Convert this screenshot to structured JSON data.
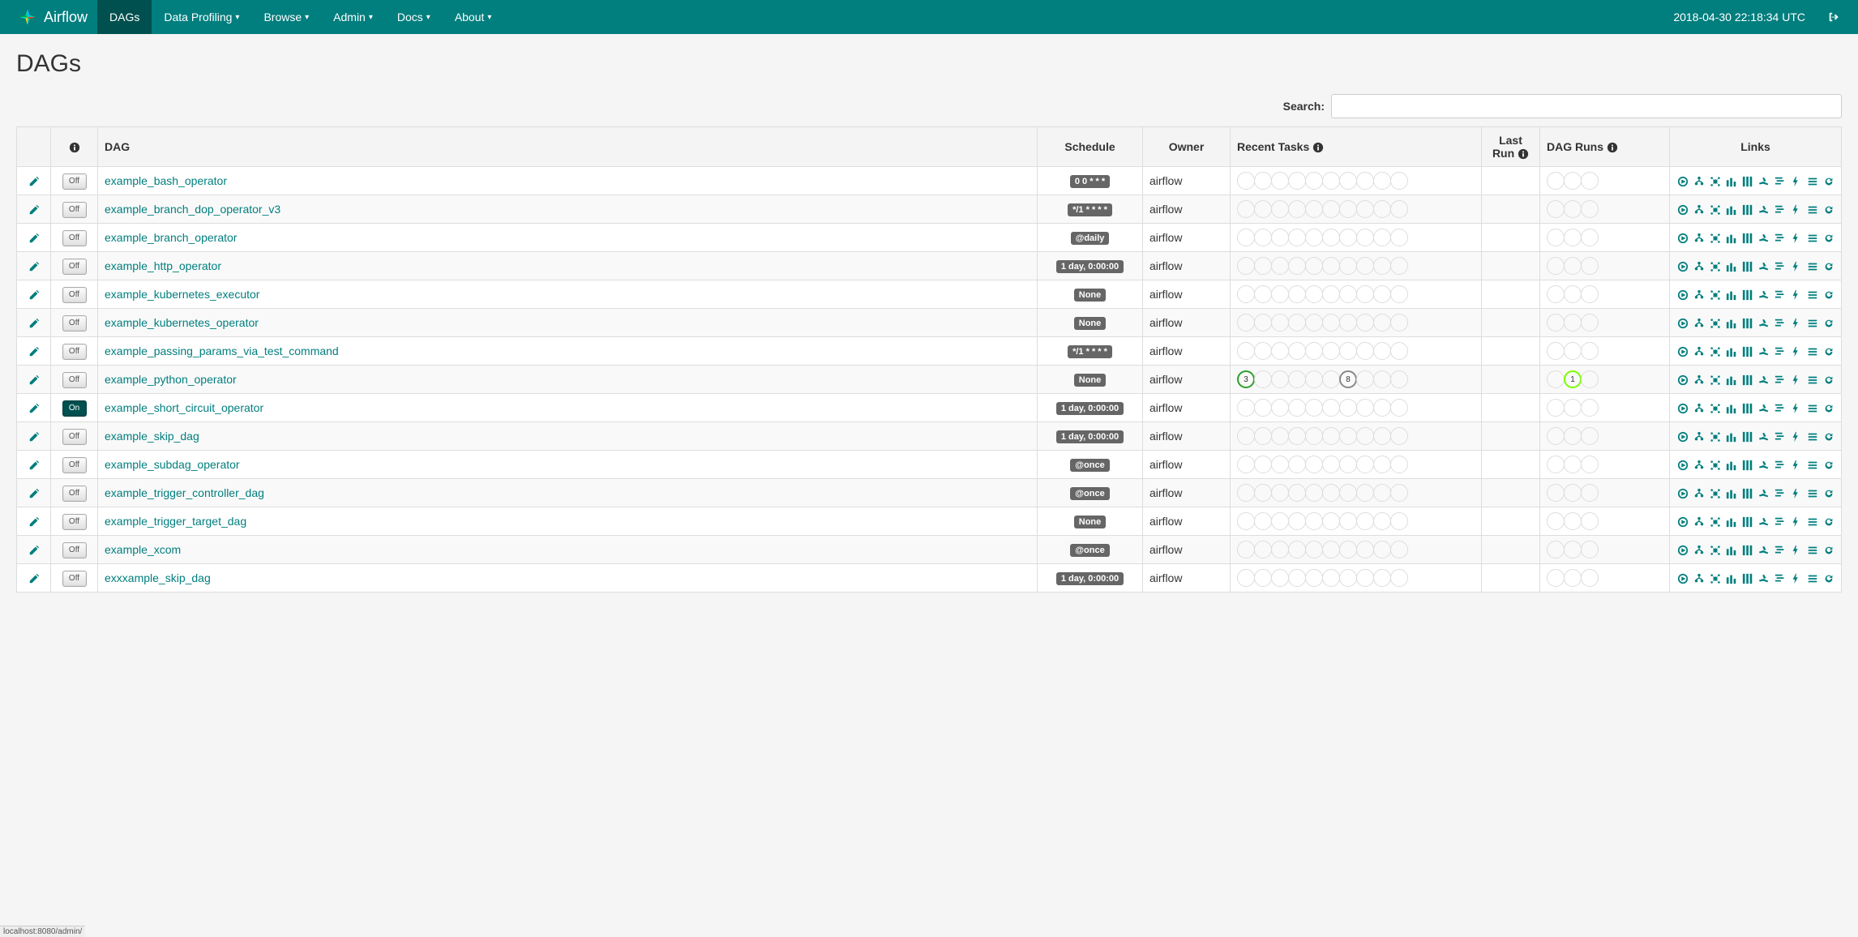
{
  "header": {
    "brand": "Airflow",
    "nav": [
      "DAGs",
      "Data Profiling",
      "Browse",
      "Admin",
      "Docs",
      "About"
    ],
    "active_index": 0,
    "timestamp": "2018-04-30 22:18:34 UTC"
  },
  "page": {
    "title": "DAGs",
    "search_label": "Search:",
    "search_value": ""
  },
  "table": {
    "headers": {
      "edit": "",
      "toggle": "",
      "dag": "DAG",
      "schedule": "Schedule",
      "owner": "Owner",
      "recent": "Recent Tasks",
      "lastrun": "Last Run",
      "dagrun": "DAG Runs",
      "links": "Links"
    },
    "rows": [
      {
        "name": "example_bash_operator",
        "toggle": "Off",
        "schedule": "0 0 * * *",
        "owner": "airflow",
        "recent": [],
        "dagrun": []
      },
      {
        "name": "example_branch_dop_operator_v3",
        "toggle": "Off",
        "schedule": "*/1 * * * *",
        "owner": "airflow",
        "recent": [],
        "dagrun": []
      },
      {
        "name": "example_branch_operator",
        "toggle": "Off",
        "schedule": "@daily",
        "owner": "airflow",
        "recent": [],
        "dagrun": []
      },
      {
        "name": "example_http_operator",
        "toggle": "Off",
        "schedule": "1 day, 0:00:00",
        "owner": "airflow",
        "recent": [],
        "dagrun": []
      },
      {
        "name": "example_kubernetes_executor",
        "toggle": "Off",
        "schedule": "None",
        "owner": "airflow",
        "recent": [],
        "dagrun": []
      },
      {
        "name": "example_kubernetes_operator",
        "toggle": "Off",
        "schedule": "None",
        "owner": "airflow",
        "recent": [],
        "dagrun": []
      },
      {
        "name": "example_passing_params_via_test_command",
        "toggle": "Off",
        "schedule": "*/1 * * * *",
        "owner": "airflow",
        "recent": [],
        "dagrun": []
      },
      {
        "name": "example_python_operator",
        "toggle": "Off",
        "schedule": "None",
        "owner": "airflow",
        "recent": [
          {
            "pos": 0,
            "cls": "success",
            "val": "3"
          },
          {
            "pos": 6,
            "cls": "queued",
            "val": "8"
          }
        ],
        "dagrun": [
          {
            "pos": 1,
            "cls": "running",
            "val": "1"
          }
        ]
      },
      {
        "name": "example_short_circuit_operator",
        "toggle": "On",
        "schedule": "1 day, 0:00:00",
        "owner": "airflow",
        "recent": [],
        "dagrun": []
      },
      {
        "name": "example_skip_dag",
        "toggle": "Off",
        "schedule": "1 day, 0:00:00",
        "owner": "airflow",
        "recent": [],
        "dagrun": []
      },
      {
        "name": "example_subdag_operator",
        "toggle": "Off",
        "schedule": "@once",
        "owner": "airflow",
        "recent": [],
        "dagrun": []
      },
      {
        "name": "example_trigger_controller_dag",
        "toggle": "Off",
        "schedule": "@once",
        "owner": "airflow",
        "recent": [],
        "dagrun": []
      },
      {
        "name": "example_trigger_target_dag",
        "toggle": "Off",
        "schedule": "None",
        "owner": "airflow",
        "recent": [],
        "dagrun": []
      },
      {
        "name": "example_xcom",
        "toggle": "Off",
        "schedule": "@once",
        "owner": "airflow",
        "recent": [],
        "dagrun": []
      },
      {
        "name": "exxxample_skip_dag",
        "toggle": "Off",
        "schedule": "1 day, 0:00:00",
        "owner": "airflow",
        "recent": [],
        "dagrun": []
      }
    ]
  },
  "link_icons": [
    "trigger",
    "tree",
    "graph",
    "tasks",
    "duration",
    "landing",
    "gantt",
    "logs",
    "code",
    "refresh"
  ],
  "status_bar": "localhost:8080/admin/"
}
